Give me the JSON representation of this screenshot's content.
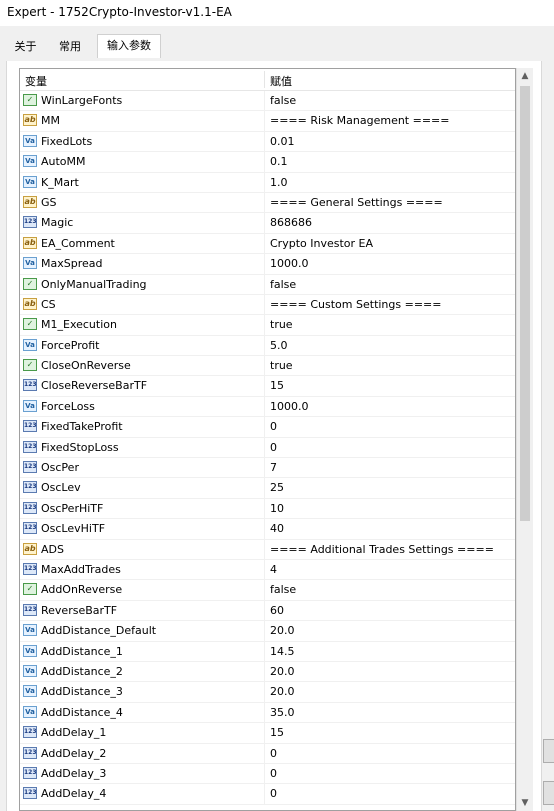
{
  "window": {
    "title": "Expert - 1752Crypto-Investor-v1.1-EA"
  },
  "tabs": [
    {
      "label": "关于"
    },
    {
      "label": "常用"
    },
    {
      "label": "输入参数"
    }
  ],
  "grid": {
    "col_variable": "变量",
    "col_value": "赋值",
    "rows": [
      {
        "type": "bool",
        "icon": "bool-icon",
        "name": "WinLargeFonts",
        "value": "false"
      },
      {
        "type": "str",
        "icon": "string-icon",
        "name": "MM",
        "value": "==== Risk Management ===="
      },
      {
        "type": "dbl",
        "icon": "double-icon",
        "name": "FixedLots",
        "value": "0.01"
      },
      {
        "type": "dbl",
        "icon": "double-icon",
        "name": "AutoMM",
        "value": "0.1"
      },
      {
        "type": "dbl",
        "icon": "double-icon",
        "name": "K_Mart",
        "value": "1.0"
      },
      {
        "type": "str",
        "icon": "string-icon",
        "name": "GS",
        "value": "==== General Settings ===="
      },
      {
        "type": "int",
        "icon": "integer-icon",
        "name": "Magic",
        "value": "868686"
      },
      {
        "type": "str",
        "icon": "string-icon",
        "name": "EA_Comment",
        "value": "Crypto Investor EA"
      },
      {
        "type": "dbl",
        "icon": "double-icon",
        "name": "MaxSpread",
        "value": "1000.0"
      },
      {
        "type": "bool",
        "icon": "bool-icon",
        "name": "OnlyManualTrading",
        "value": "false"
      },
      {
        "type": "str",
        "icon": "string-icon",
        "name": "CS",
        "value": "==== Custom Settings ===="
      },
      {
        "type": "bool",
        "icon": "bool-icon",
        "name": "M1_Execution",
        "value": "true"
      },
      {
        "type": "dbl",
        "icon": "double-icon",
        "name": "ForceProfit",
        "value": "5.0"
      },
      {
        "type": "bool",
        "icon": "bool-icon",
        "name": "CloseOnReverse",
        "value": "true"
      },
      {
        "type": "int",
        "icon": "integer-icon",
        "name": "CloseReverseBarTF",
        "value": "15"
      },
      {
        "type": "dbl",
        "icon": "double-icon",
        "name": "ForceLoss",
        "value": "1000.0"
      },
      {
        "type": "int",
        "icon": "integer-icon",
        "name": "FixedTakeProfit",
        "value": "0"
      },
      {
        "type": "int",
        "icon": "integer-icon",
        "name": "FixedStopLoss",
        "value": "0"
      },
      {
        "type": "int",
        "icon": "integer-icon",
        "name": "OscPer",
        "value": "7"
      },
      {
        "type": "int",
        "icon": "integer-icon",
        "name": "OscLev",
        "value": "25"
      },
      {
        "type": "int",
        "icon": "integer-icon",
        "name": "OscPerHiTF",
        "value": "10"
      },
      {
        "type": "int",
        "icon": "integer-icon",
        "name": "OscLevHiTF",
        "value": "40"
      },
      {
        "type": "str",
        "icon": "string-icon",
        "name": "ADS",
        "value": "==== Additional Trades Settings ===="
      },
      {
        "type": "int",
        "icon": "integer-icon",
        "name": "MaxAddTrades",
        "value": "4"
      },
      {
        "type": "bool",
        "icon": "bool-icon",
        "name": "AddOnReverse",
        "value": "false"
      },
      {
        "type": "int",
        "icon": "integer-icon",
        "name": "ReverseBarTF",
        "value": "60"
      },
      {
        "type": "dbl",
        "icon": "double-icon",
        "name": "AddDistance_Default",
        "value": "20.0"
      },
      {
        "type": "dbl",
        "icon": "double-icon",
        "name": "AddDistance_1",
        "value": "14.5"
      },
      {
        "type": "dbl",
        "icon": "double-icon",
        "name": "AddDistance_2",
        "value": "20.0"
      },
      {
        "type": "dbl",
        "icon": "double-icon",
        "name": "AddDistance_3",
        "value": "20.0"
      },
      {
        "type": "dbl",
        "icon": "double-icon",
        "name": "AddDistance_4",
        "value": "35.0"
      },
      {
        "type": "int",
        "icon": "integer-icon",
        "name": "AddDelay_1",
        "value": "15"
      },
      {
        "type": "int",
        "icon": "integer-icon",
        "name": "AddDelay_2",
        "value": "0"
      },
      {
        "type": "int",
        "icon": "integer-icon",
        "name": "AddDelay_3",
        "value": "0"
      },
      {
        "type": "int",
        "icon": "integer-icon",
        "name": "AddDelay_4",
        "value": "0"
      }
    ]
  },
  "colors": {
    "panel_bg": "#f0f0f0",
    "grid_border": "#a0a0a0"
  }
}
